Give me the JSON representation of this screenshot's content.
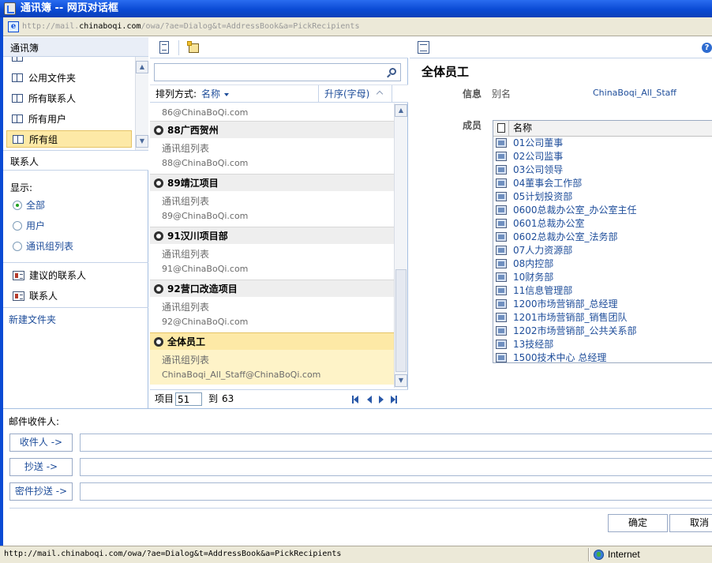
{
  "window": {
    "title": "通讯簿 -- 网页对话框",
    "url_prefix": "http://mail.",
    "url_domain": "chinaboqi.com",
    "url_rest": "/owa/?ae=Dialog&t=AddressBook&a=PickRecipients"
  },
  "nav": {
    "header": "通讯簿",
    "folders": [
      {
        "label": "公用文件夹"
      },
      {
        "label": "所有联系人"
      },
      {
        "label": "所有用户"
      },
      {
        "label": "所有组"
      }
    ],
    "contacts_header": "联系人",
    "show_label": "显示:",
    "filters": [
      {
        "label": "全部",
        "checked": true
      },
      {
        "label": "用户",
        "checked": false
      },
      {
        "label": "通讯组列表",
        "checked": false
      }
    ],
    "links": [
      {
        "label": "建议的联系人"
      },
      {
        "label": "联系人"
      }
    ],
    "new_folder": "新建文件夹"
  },
  "list": {
    "sort_label": "排列方式:",
    "sort_value": "名称",
    "sort_order": "升序(字母)",
    "top_fragment": "86@ChinaBoQi.com",
    "items": [
      {
        "name": "88广西贺州",
        "type": "通讯组列表",
        "email": "88@ChinaBoQi.com"
      },
      {
        "name": "89靖江项目",
        "type": "通讯组列表",
        "email": "89@ChinaBoQi.com"
      },
      {
        "name": "91汉川项目部",
        "type": "通讯组列表",
        "email": "91@ChinaBoQi.com"
      },
      {
        "name": "92营口改造项目",
        "type": "通讯组列表",
        "email": "92@ChinaBoQi.com"
      },
      {
        "name": "全体员工",
        "type": "通讯组列表",
        "email": "ChinaBoqi_All_Staff@ChinaBoQi.com"
      }
    ],
    "pager": {
      "label": "项目",
      "current": "51",
      "to": "到",
      "total": "63"
    }
  },
  "detail": {
    "title": "全体员工",
    "info_label": "信息",
    "alias_label": "别名",
    "alias_value": "ChinaBoqi_All_Staff",
    "members_label": "成员",
    "members_header": "名称",
    "members": [
      "01公司董事",
      "02公司监事",
      "03公司领导",
      "04董事会工作部",
      "05计划投资部",
      "0600总裁办公室_办公室主任",
      "0601总裁办公室",
      "0602总裁办公室_法务部",
      "07人力资源部",
      "08内控部",
      "10财务部",
      "11信息管理部",
      "1200市场营销部_总经理",
      "1201市场营销部_销售团队",
      "1202市场营销部_公共关系部",
      "13技经部",
      "1500技术中心 总经理"
    ]
  },
  "recipients": {
    "title": "邮件收件人:",
    "to_button": "收件人 ->",
    "cc_button": "抄送 ->",
    "bcc_button": "密件抄送 ->",
    "ok": "确定",
    "cancel": "取消"
  },
  "status": {
    "url": "http://mail.chinaboqi.com/owa/?ae=Dialog&t=AddressBook&a=PickRecipients",
    "zone": "Internet"
  }
}
